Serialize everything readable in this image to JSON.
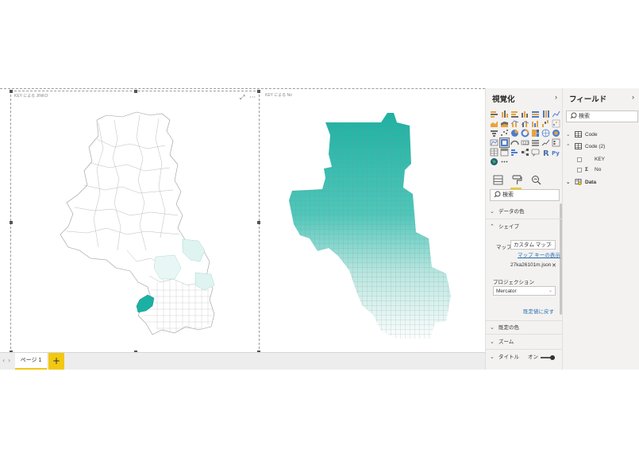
{
  "canvas": {
    "visual1": {
      "title": "KEY による JINKO"
    },
    "visual2": {
      "title": "KEY による No"
    }
  },
  "pages": {
    "tab_label": "ページ 1",
    "add_label": "+"
  },
  "visualizations": {
    "title": "視覚化",
    "search_placeholder": "検索",
    "sections": {
      "data_colors": "データの色",
      "shape": "シェイプ",
      "default_colors": "既定の色",
      "zoom": "ズーム",
      "title": "タイトル"
    },
    "map_label": "マップ",
    "map_select": "カスタム マップ",
    "map_keys_link": "マップ キーの表示",
    "map_file": "27ka26101m.json",
    "projection_label": "プロジェクション",
    "projection_select": "Mercator",
    "reset_link": "既定値に戻す",
    "title_toggle": "オン"
  },
  "fields": {
    "title": "フィールド",
    "search_placeholder": "検索",
    "tables": [
      {
        "name": "Code"
      },
      {
        "name": "Code (2)",
        "columns": [
          "KEY",
          "No"
        ]
      },
      {
        "name": "Data"
      }
    ]
  },
  "colors": {
    "teal": "#1bb1a2",
    "teal_light": "#e3f6f3",
    "accent_yellow": "#f2c811"
  }
}
